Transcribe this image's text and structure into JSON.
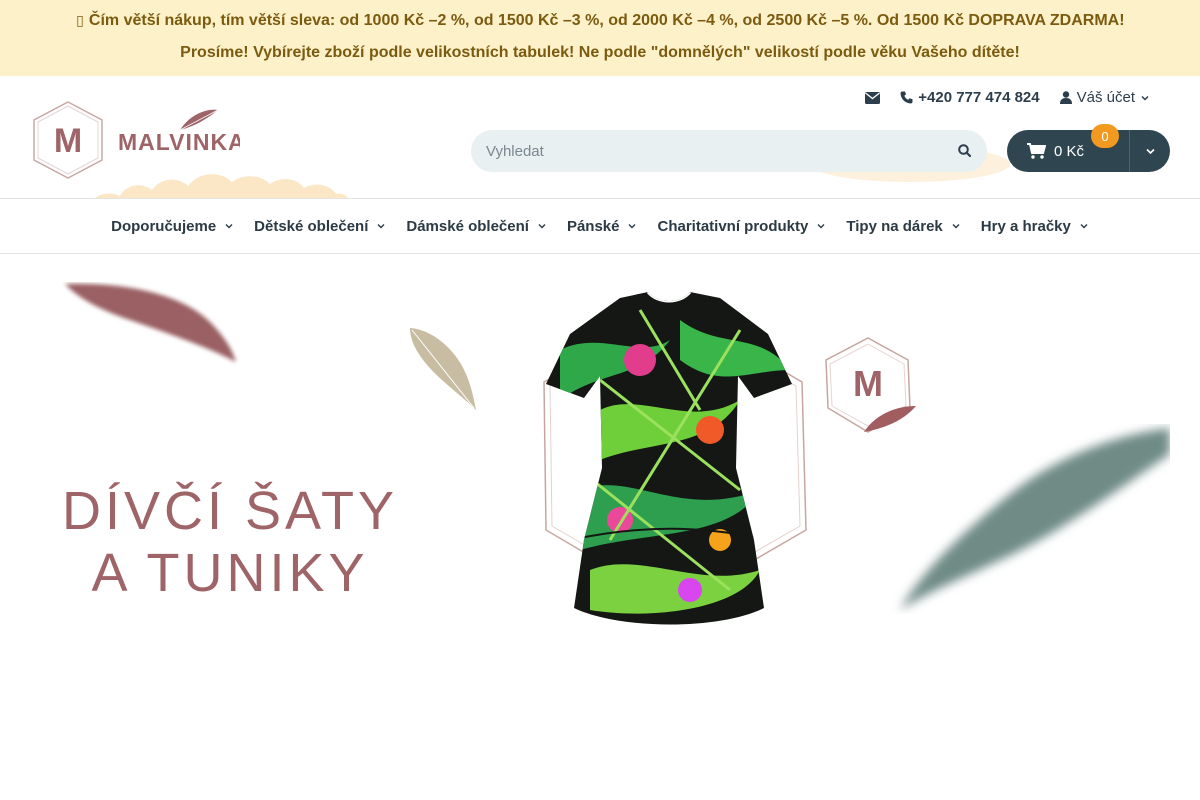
{
  "promo": {
    "line1_icon": "",
    "line1": "Čím větší nákup, tím větší sleva: od 1000 Kč –2 %, od 1500 Kč –3 %, od 2000 Kč –4 %, od 2500 Kč –5 %. Od 1500 Kč DOPRAVA ZDARMA!",
    "line2": "Prosíme! Vybírejte zboží podle velikostních tabulek! Ne podle \"domnělých\" velikostí podle věku Vašeho dítěte!"
  },
  "header": {
    "logo_text": "MALVINKA",
    "logo_letter": "M",
    "phone": "+420 777 474 824",
    "account": "Váš účet",
    "search_placeholder": "Vyhledat",
    "cart_total": "0 Kč",
    "cart_count": "0"
  },
  "nav": {
    "items": [
      {
        "label": "Doporučujeme"
      },
      {
        "label": "Dětské oblečení"
      },
      {
        "label": "Dámské oblečení"
      },
      {
        "label": "Pánské"
      },
      {
        "label": "Charitativní produkty"
      },
      {
        "label": "Tipy na dárek"
      },
      {
        "label": "Hry a hračky"
      }
    ]
  },
  "hero": {
    "title_line1": "DÍVČÍ ŠATY",
    "title_line2": "A TUNIKY",
    "badge_letter": "M"
  },
  "colors": {
    "promo_bg": "#fdf1c9",
    "brand": "#9e6468",
    "dark": "#2f4550",
    "badge": "#f29a1f"
  }
}
